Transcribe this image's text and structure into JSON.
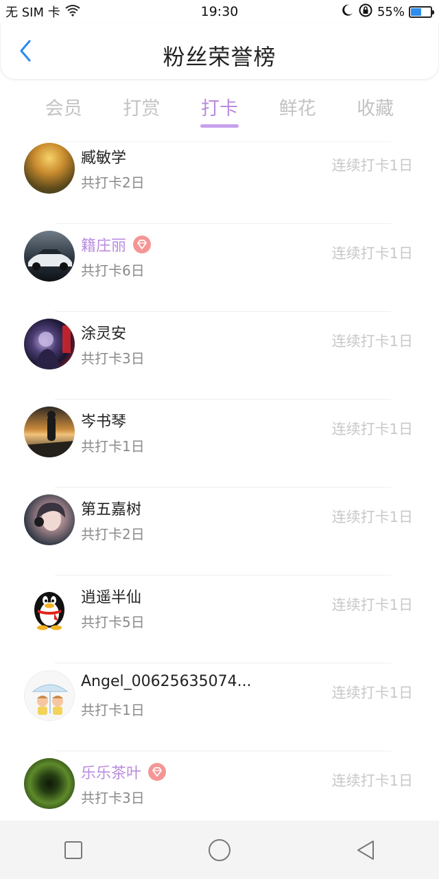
{
  "status_bar": {
    "carrier": "无 SIM 卡",
    "time": "19:30",
    "battery": "55%",
    "battery_level": 0.55,
    "icons": [
      "wifi-icon",
      "moon-icon",
      "rotation-lock-icon",
      "battery-icon"
    ]
  },
  "header": {
    "title": "粉丝荣誉榜",
    "back_icon": "chevron-left-icon"
  },
  "tabs": [
    {
      "label": "会员",
      "active": false
    },
    {
      "label": "打赏",
      "active": false
    },
    {
      "label": "打卡",
      "active": true
    },
    {
      "label": "鲜花",
      "active": false
    },
    {
      "label": "收藏",
      "active": false
    }
  ],
  "colors": {
    "accent": "#b98bdf",
    "back_arrow": "#2d8cf0",
    "vip_badge": "#f49695"
  },
  "list": [
    {
      "name": "臧敏学",
      "total": "共打卡2日",
      "streak": "连续打卡1日",
      "vip": false,
      "avatar": "forest"
    },
    {
      "name": "籍庄丽",
      "total": "共打卡6日",
      "streak": "连续打卡1日",
      "vip": true,
      "avatar": "car"
    },
    {
      "name": "涂灵安",
      "total": "共打卡3日",
      "streak": "连续打卡1日",
      "vip": false,
      "avatar": "concert"
    },
    {
      "name": "岑书琴",
      "total": "共打卡1日",
      "streak": "连续打卡1日",
      "vip": false,
      "avatar": "sunset"
    },
    {
      "name": "第五嘉树",
      "total": "共打卡2日",
      "streak": "连续打卡1日",
      "vip": false,
      "avatar": "girl"
    },
    {
      "name": "逍遥半仙",
      "total": "共打卡5日",
      "streak": "连续打卡1日",
      "vip": false,
      "avatar": "qq"
    },
    {
      "name": "Angel_00625635074...",
      "total": "共打卡1日",
      "streak": "连续打卡1日",
      "vip": false,
      "avatar": "cartoon"
    },
    {
      "name": "乐乐茶叶",
      "total": "共打卡3日",
      "streak": "连续打卡1日",
      "vip": true,
      "avatar": "tunnel"
    }
  ],
  "nav": {
    "icons": [
      "square-icon",
      "circle-icon",
      "triangle-back-icon"
    ]
  }
}
